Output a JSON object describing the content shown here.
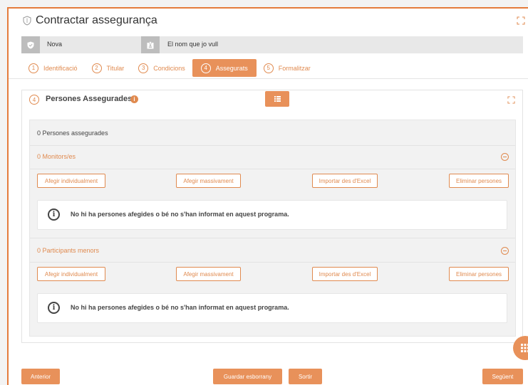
{
  "header": {
    "title": "Contractar assegurança",
    "icon": "shield-icon",
    "expand_icon": "expand-icon"
  },
  "info_bar": {
    "status": "Nova",
    "status_icon": "shield-check-icon",
    "name": "El nom que jo vull",
    "name_icon": "id-card-icon"
  },
  "steps": [
    {
      "num": "1",
      "label": "Identificació",
      "active": false
    },
    {
      "num": "2",
      "label": "Titular",
      "active": false
    },
    {
      "num": "3",
      "label": "Condicions",
      "active": false
    },
    {
      "num": "4",
      "label": "Assegurats",
      "active": true
    },
    {
      "num": "5",
      "label": "Formalitzar",
      "active": false
    }
  ],
  "panel": {
    "num": "4",
    "title": "Persones Assegurades",
    "info_icon": "info-icon",
    "toggle_icon": "list-icon",
    "expand_icon": "expand-icon",
    "count_text": "0 Persones assegurades"
  },
  "groups": [
    {
      "title": "0 Monitors/es",
      "buttons": [
        "Afegir individualment",
        "Afegir massivament",
        "Importar des d'Excel",
        "Eliminar persones"
      ],
      "empty_message": "No hi ha persones afegides o bé no s'han informat en aquest programa."
    },
    {
      "title": "0 Participants menors",
      "buttons": [
        "Afegir individualment",
        "Afegir massivament",
        "Importar des d'Excel",
        "Eliminar persones"
      ],
      "empty_message": "No hi ha persones afegides o bé no s'han informat en aquest programa."
    }
  ],
  "footer": {
    "previous": "Anterior",
    "save_draft": "Guardar esborrany",
    "exit": "Sortir",
    "next": "Següent"
  },
  "colors": {
    "accent": "#e8915a",
    "accent_text": "#e08a4f",
    "frame": "#e57b3c"
  },
  "fab_icon": "grid-icon"
}
